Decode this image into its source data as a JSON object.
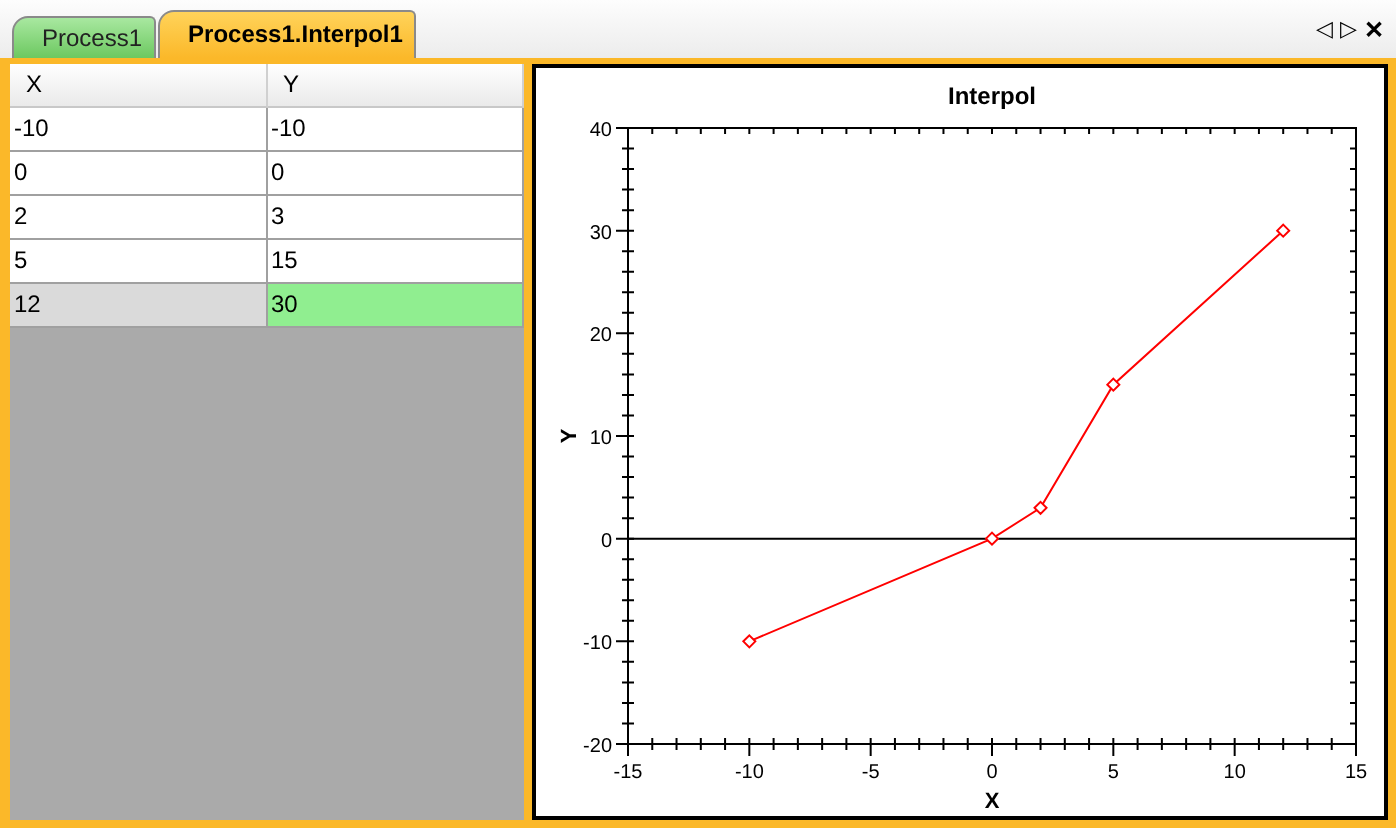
{
  "tabs": [
    {
      "label": "Process1",
      "selected": false
    },
    {
      "label": "Process1.Interpol1",
      "selected": true
    }
  ],
  "nav": {
    "prev": "◁",
    "next": "▷",
    "close": "✕"
  },
  "grid": {
    "columns": [
      "X",
      "Y"
    ],
    "rows": [
      {
        "cells": [
          "-10",
          "-10"
        ],
        "selected": false
      },
      {
        "cells": [
          "0",
          "0"
        ],
        "selected": false
      },
      {
        "cells": [
          "2",
          "3"
        ],
        "selected": false
      },
      {
        "cells": [
          "5",
          "15"
        ],
        "selected": false
      },
      {
        "cells": [
          "12",
          "30"
        ],
        "selected": true
      }
    ]
  },
  "chart": {
    "chart_data": {
      "type": "line",
      "title": "Interpol",
      "xlabel": "X",
      "ylabel": "Y",
      "x": [
        -10,
        0,
        2,
        5,
        12
      ],
      "series": [
        {
          "color": "#ff0000",
          "marker": "diamond",
          "values": [
            -10,
            0,
            3,
            15,
            30
          ]
        }
      ],
      "xlim": [
        -15,
        15
      ],
      "ylim": [
        -20,
        40
      ],
      "xticks": [
        -15,
        -10,
        -5,
        0,
        5,
        10,
        15
      ],
      "yticks": [
        -20,
        -10,
        0,
        10,
        20,
        30,
        40
      ]
    }
  }
}
